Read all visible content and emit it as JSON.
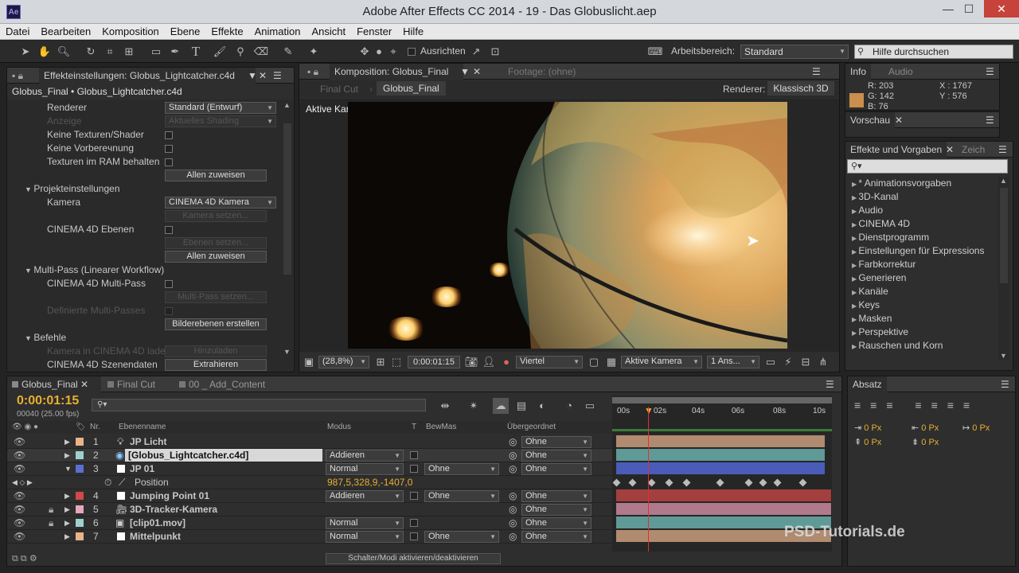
{
  "window": {
    "title": "Adobe After Effects CC 2014 - 19 - Das Globuslicht.aep",
    "logo": "Ae",
    "minimize": "—",
    "maximize": "☐",
    "close": "✕"
  },
  "menu": [
    "Datei",
    "Bearbeiten",
    "Komposition",
    "Ebene",
    "Effekte",
    "Animation",
    "Ansicht",
    "Fenster",
    "Hilfe"
  ],
  "toolbar": {
    "align_label": "Ausrichten",
    "workspace_label": "Arbeitsbereich:",
    "workspace_value": "Standard",
    "search_placeholder": "Hilfe durchsuchen"
  },
  "effects_panel": {
    "tab": "Effekteinstellungen: Globus_Lightcatcher.c4d",
    "breadcrumb": "Globus_Final • Globus_Lightcatcher.c4d",
    "renderer_label": "Renderer",
    "renderer_value": "Standard (Entwurf)",
    "anzeige_label": "Anzeige",
    "anzeige_value": "Aktuelles Shading",
    "keine_texturen": "Keine Texturen/Shader",
    "keine_vorbereitung": "Keine Vorbereчnung",
    "texturen_ram": "Texturen im RAM behalten",
    "allen_zuweisen": "Allen zuweisen",
    "projekt": "Projekteinstellungen",
    "kamera_label": "Kamera",
    "kamera_value": "CINEMA 4D Kamera",
    "kamera_setzen": "Kamera setzen...",
    "c4d_ebenen": "CINEMA 4D Ebenen",
    "ebenen_setzen": "Ebenen setzen...",
    "allen_zuweisen2": "Allen zuweisen",
    "multipass": "Multi-Pass (Linearer Workflow)",
    "c4d_multipass": "CINEMA 4D Multi-Pass",
    "multipass_setzen": "Multi-Pass setzen...",
    "definierte": "Definierte Multi-Passes",
    "bilderebenen": "Bilderebenen erstellen",
    "befehle": "Befehle",
    "kamera_laden": "Kamera in CINEMA 4D lade",
    "hinzuladen": "Hinzuladen",
    "szenendaten": "CINEMA 4D Szenendaten",
    "extrahieren": "Extrahieren"
  },
  "comp_panel": {
    "tab": "Komposition: Globus_Final",
    "footage_tab": "Footage: (ohne)",
    "sub_final_cut": "Final Cut",
    "sub_globus": "Globus_Final",
    "renderer_label": "Renderer:",
    "renderer_value": "Klassisch 3D",
    "view_label": "Aktive Kamera",
    "zoom": "(28,8%)",
    "timecode": "0:00:01:15",
    "resolution": "Viertel",
    "camera": "Aktive Kamera",
    "views": "1 Ans..."
  },
  "info_panel": {
    "tab_info": "Info",
    "tab_audio": "Audio",
    "r": "R: 203",
    "g": "G: 142",
    "b": "B: 76",
    "x": "X : 1767",
    "y": "Y : 576",
    "swatch_color": "#cb8e4c"
  },
  "preview_panel": {
    "tab": "Vorschau"
  },
  "effects_presets": {
    "tab": "Effekte und Vorgaben",
    "tab2": "Zeich",
    "items": [
      "* Animationsvorgaben",
      "3D-Kanal",
      "Audio",
      "CINEMA 4D",
      "Dienstprogramm",
      "Einstellungen für Expressions",
      "Farbkorrektur",
      "Generieren",
      "Kanäle",
      "Keys",
      "Masken",
      "Perspektive",
      "Rauschen und Korn"
    ]
  },
  "timeline": {
    "tabs": [
      "Globus_Final",
      "Final Cut",
      "00 _ Add_Content"
    ],
    "timecode": "0:00:01:15",
    "frames": "00040 (25.00 fps)",
    "columns": {
      "nr": "Nr.",
      "name": "Ebenenname",
      "modus": "Modus",
      "t": "T",
      "bewmas": "BewMas",
      "parent": "Übergeordnet"
    },
    "ruler": [
      "00s",
      "02s",
      "04s",
      "06s",
      "08s",
      "10s"
    ],
    "layers": [
      {
        "nr": "1",
        "name": "JP Licht",
        "modus": "",
        "bewmas": "",
        "parent": "Ohne",
        "color": "#e8b48a",
        "bar": "#b08b70"
      },
      {
        "nr": "2",
        "name": "[Globus_Lightcatcher.c4d]",
        "modus": "Addieren",
        "bewmas": "",
        "parent": "Ohne",
        "color": "#9fd0cc",
        "bar": "#5f9a97"
      },
      {
        "nr": "3",
        "name": "JP 01",
        "modus": "Normal",
        "bewmas": "Ohne",
        "parent": "Ohne",
        "color": "#5c6fd0",
        "bar": "#4a5cb8"
      },
      {
        "nr": "",
        "name": "Position",
        "modus": "987,5,328,9,-1407,0",
        "bewmas": "",
        "parent": "",
        "color": "",
        "bar": ""
      },
      {
        "nr": "4",
        "name": "Jumping Point 01",
        "modus": "Addieren",
        "bewmas": "Ohne",
        "parent": "Ohne",
        "color": "#d04848",
        "bar": "#a33f3f"
      },
      {
        "nr": "5",
        "name": "3D-Tracker-Kamera",
        "modus": "",
        "bewmas": "",
        "parent": "Ohne",
        "color": "#e2a8bb",
        "bar": "#b07a8c"
      },
      {
        "nr": "6",
        "name": "[clip01.mov]",
        "modus": "Normal",
        "bewmas": "",
        "parent": "Ohne",
        "color": "#9fd0cc",
        "bar": "#5f9a97"
      },
      {
        "nr": "7",
        "name": "Mittelpunkt",
        "modus": "Normal",
        "bewmas": "Ohne",
        "parent": "Ohne",
        "color": "#e8b48a",
        "bar": "#b08b70"
      }
    ],
    "footer": "Schalter/Modi aktivieren/deaktivieren"
  },
  "absatz_panel": {
    "tab": "Absatz",
    "v1": "0 Px",
    "v2": "0 Px",
    "v3": "0 Px",
    "v4": "0 Px",
    "v5": "0 Px"
  },
  "watermark": "PSD-Tutorials.de"
}
